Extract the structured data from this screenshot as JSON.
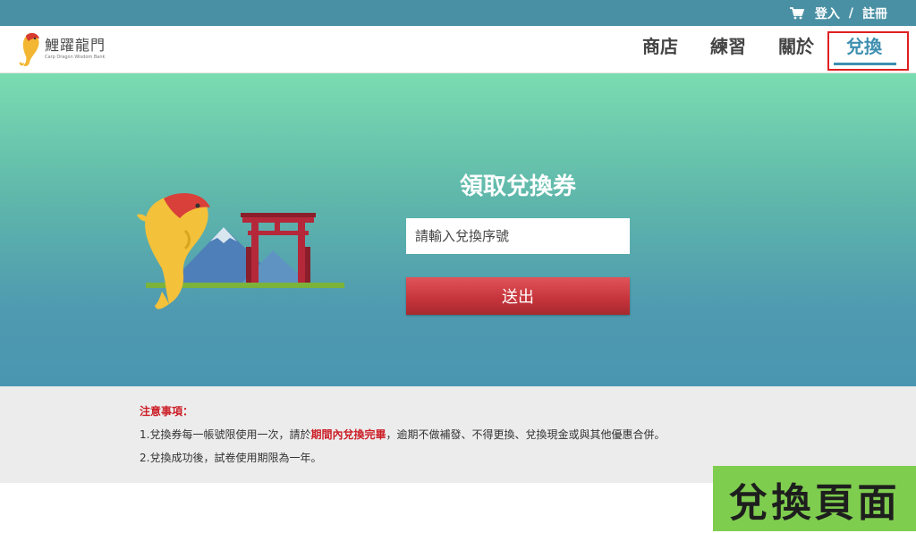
{
  "topbar": {
    "cart_icon": "shopping-cart-icon",
    "login_label": "登入",
    "separator": "/",
    "register_label": "註冊",
    "background": "#4a90a4"
  },
  "logo": {
    "brand_name": "鯉躍龍門",
    "brand_subtitle": "Carp Dragon Wisdom Bank"
  },
  "nav": {
    "items": [
      {
        "label": "商店"
      },
      {
        "label": "練習"
      },
      {
        "label": "關於"
      },
      {
        "label": "兌換",
        "active": true
      }
    ],
    "active_color": "#3e8fb0",
    "highlight_color": "#e02020"
  },
  "hero": {
    "title": "領取兌換券",
    "input_placeholder": "請輸入兌換序號",
    "submit_label": "送出",
    "gradient_top": "#7adcb0",
    "gradient_bottom": "#4a96b1"
  },
  "notice": {
    "title": "注意事項：",
    "line1_prefix": "1.兌換券每一帳號限使用一次，請於",
    "line1_emphasis": "期間內兌換完畢",
    "line1_suffix": "，逾期不做補發、不得更換、兌換現金或與其他優惠合併。",
    "line2": "2.兌換成功後，試卷使用期限為一年。"
  },
  "caption": {
    "text": "兌換頁面",
    "background": "#7fcd4f"
  }
}
